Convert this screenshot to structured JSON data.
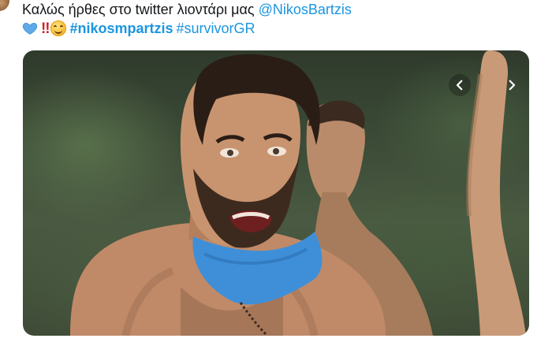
{
  "tweet": {
    "text_prefix": "Καλώς ήρθες στο twitter λιοντάρι μας ",
    "mention": "@NikosBartzis",
    "hashtag_primary": "#nikosmpartzis",
    "hashtag_secondary": "#survivorGR",
    "emojis": [
      "blue-heart",
      "double-exclamation",
      "smiling-face"
    ],
    "double_exclamation": "‼"
  },
  "media": {
    "has_prev": true,
    "has_next": true
  },
  "colors": {
    "link": "#1b95e0",
    "text": "#14171a",
    "bandana": "#3f8fd8"
  }
}
